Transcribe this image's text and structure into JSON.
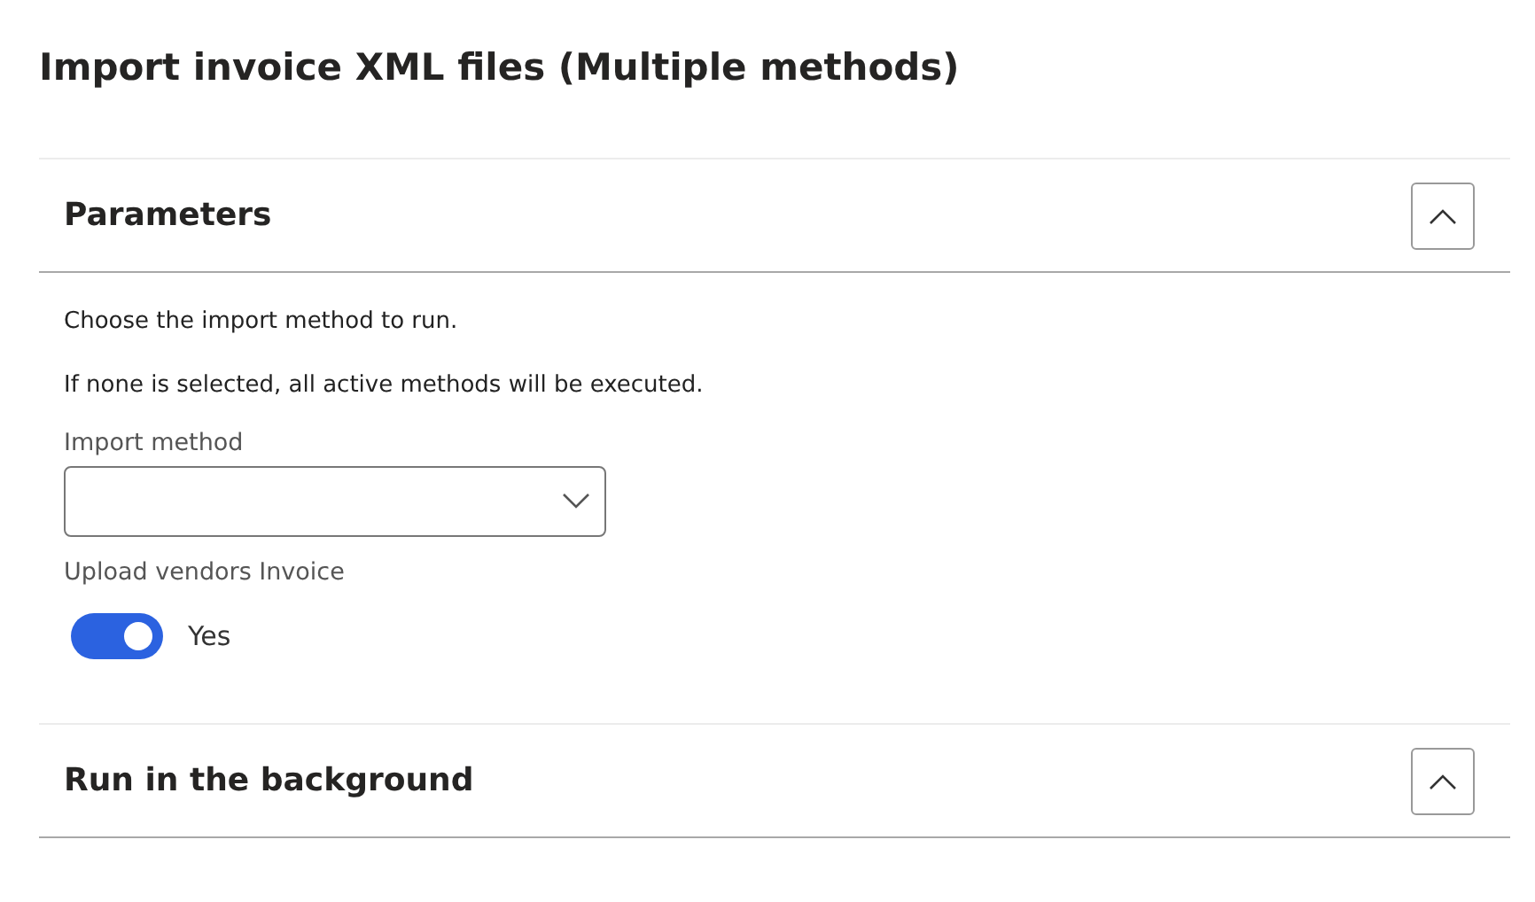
{
  "page_title": "Import invoice XML files (Multiple methods)",
  "sections": [
    {
      "title": "Parameters",
      "expanded": true,
      "notes": [
        "Choose the import method to run.",
        "If none is selected, all active methods will be executed."
      ],
      "fields": [
        {
          "kind": "dropdown",
          "label": "Import method"
        },
        {
          "kind": "toggle",
          "label": "Upload vendors Invoice",
          "on": true,
          "state_text": "Yes"
        }
      ]
    },
    {
      "title": "Run in the background",
      "expanded": true
    }
  ]
}
